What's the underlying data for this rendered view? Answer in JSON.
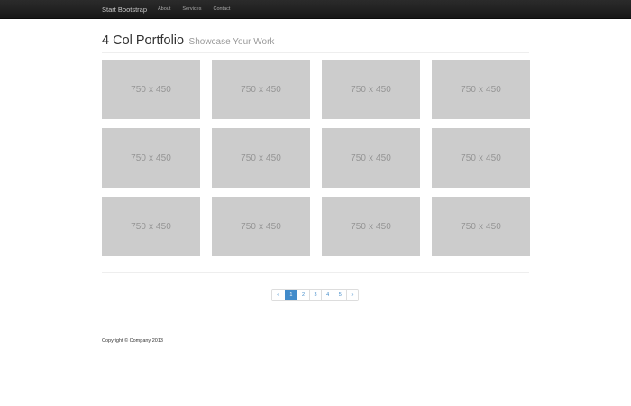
{
  "navbar": {
    "brand": "Start Bootstrap",
    "links": [
      "About",
      "Services",
      "Contact"
    ]
  },
  "header": {
    "title": "4 Col Portfolio",
    "subtitle": "Showcase Your Work"
  },
  "portfolio": {
    "items": [
      "750 x 450",
      "750 x 450",
      "750 x 450",
      "750 x 450",
      "750 x 450",
      "750 x 450",
      "750 x 450",
      "750 x 450",
      "750 x 450",
      "750 x 450",
      "750 x 450",
      "750 x 450"
    ]
  },
  "pagination": {
    "prev": "«",
    "pages": [
      "1",
      "2",
      "3",
      "4",
      "5"
    ],
    "next": "»",
    "active": "1",
    "active_color": "#428bca"
  },
  "footer": {
    "copyright": "Copyright © Company 2013"
  }
}
